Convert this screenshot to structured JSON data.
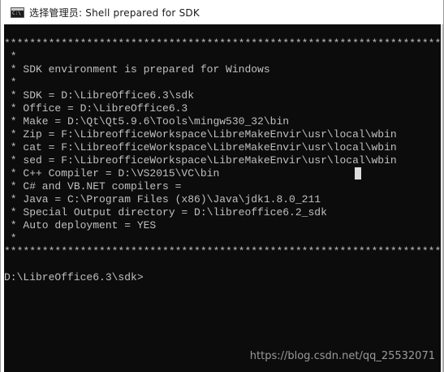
{
  "window": {
    "title": "选择管理员:  Shell prepared for SDK"
  },
  "console": {
    "lines": [
      "******************************************************************************",
      " *",
      " * SDK environment is prepared for Windows",
      " *",
      " * SDK = D:\\LibreOffice6.3\\sdk",
      " * Office = D:\\LibreOffice6.3",
      " * Make = D:\\Qt\\Qt5.9.6\\Tools\\mingw530_32\\bin",
      " * Zip = F:\\LibreofficeWorkspace\\LibreMakeEnvir\\usr\\local\\wbin",
      " * cat = F:\\LibreofficeWorkspace\\LibreMakeEnvir\\usr\\local\\wbin",
      " * sed = F:\\LibreofficeWorkspace\\LibreMakeEnvir\\usr\\local\\wbin",
      " * C++ Compiler = D:\\VS2015\\VC\\bin",
      " * C# and VB.NET compilers =",
      " * Java = C:\\Program Files (x86)\\Java\\jdk1.8.0_211",
      " * Special Output directory = D:\\libreoffice6.2_sdk",
      " * Auto deployment = YES",
      " *",
      "******************************************************************************",
      "",
      "D:\\LibreOffice6.3\\sdk>"
    ]
  },
  "watermark": "https://blog.csdn.net/qq_25532071"
}
